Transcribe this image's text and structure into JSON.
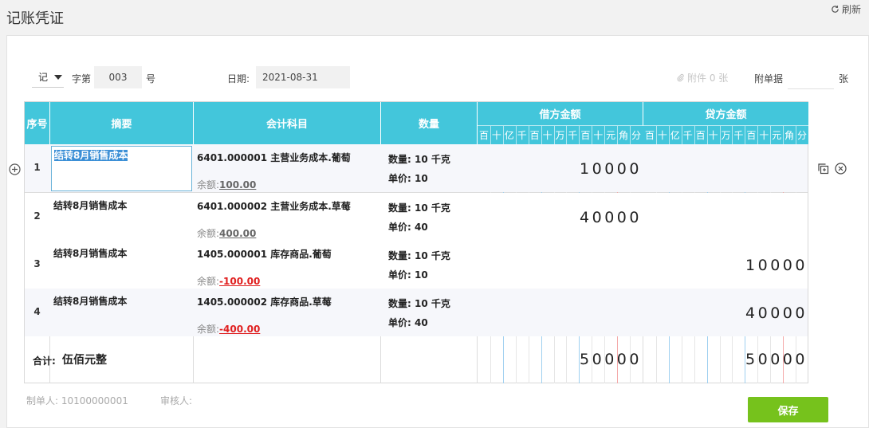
{
  "page": {
    "title": "记账凭证",
    "refresh_label": "刷新"
  },
  "form": {
    "voucher_type": "记",
    "zi_di_label": "字第",
    "voucher_no": "003",
    "hao_label": "号",
    "date_label": "日期:",
    "date_value": "2021-08-31",
    "attachments_label": "附件 0 张",
    "attached_docs_label": "附单据",
    "attached_docs_value": "",
    "zhang_label": "张"
  },
  "table": {
    "headers": {
      "row_no": "序号",
      "summary": "摘要",
      "account": "会计科目",
      "quantity": "数量",
      "debit": "借方金额",
      "credit": "贷方金额"
    },
    "digit_units": [
      "百",
      "十",
      "亿",
      "千",
      "百",
      "十",
      "万",
      "千",
      "百",
      "十",
      "元",
      "角",
      "分"
    ],
    "rows": [
      {
        "no": "1",
        "summary": "结转8月销售成本",
        "account": "6401.000001 主营业务成本.葡萄",
        "balance_label": "余额:",
        "balance": "100.00",
        "balance_negative": false,
        "qty_line": "数量: 10 千克",
        "price_line": "单价: 10",
        "debit": "10000",
        "credit": ""
      },
      {
        "no": "2",
        "summary": "结转8月销售成本",
        "account": "6401.000002 主营业务成本.草莓",
        "balance_label": "余额:",
        "balance": "400.00",
        "balance_negative": false,
        "qty_line": "数量: 10 千克",
        "price_line": "单价: 40",
        "debit": "40000",
        "credit": ""
      },
      {
        "no": "3",
        "summary": "结转8月销售成本",
        "account": "1405.000001 库存商品.葡萄",
        "balance_label": "余额:",
        "balance": "-100.00",
        "balance_negative": true,
        "qty_line": "数量: 10 千克",
        "price_line": "单价: 10",
        "debit": "",
        "credit": "10000"
      },
      {
        "no": "4",
        "summary": "结转8月销售成本",
        "account": "1405.000002 库存商品.草莓",
        "balance_label": "余额:",
        "balance": "-400.00",
        "balance_negative": true,
        "qty_line": "数量: 10 千克",
        "price_line": "单价: 40",
        "debit": "",
        "credit": "40000"
      }
    ],
    "total": {
      "label": "合计:",
      "words": "伍佰元整",
      "debit": "50000",
      "credit": "50000"
    }
  },
  "footer": {
    "maker": "制单人: 10100000001",
    "reviewer": "审核人:",
    "save_label": "保存"
  },
  "icons": [
    "add-row-icon",
    "copy-row-icon",
    "delete-row-icon",
    "refresh-icon",
    "attachment-icon"
  ],
  "colors": {
    "header_bg": "#43c6db",
    "save_button": "#76c21c",
    "negative": "#e02020",
    "yuan_divider": "#f4a8a8",
    "thousand_divider": "#9fd0f0"
  }
}
